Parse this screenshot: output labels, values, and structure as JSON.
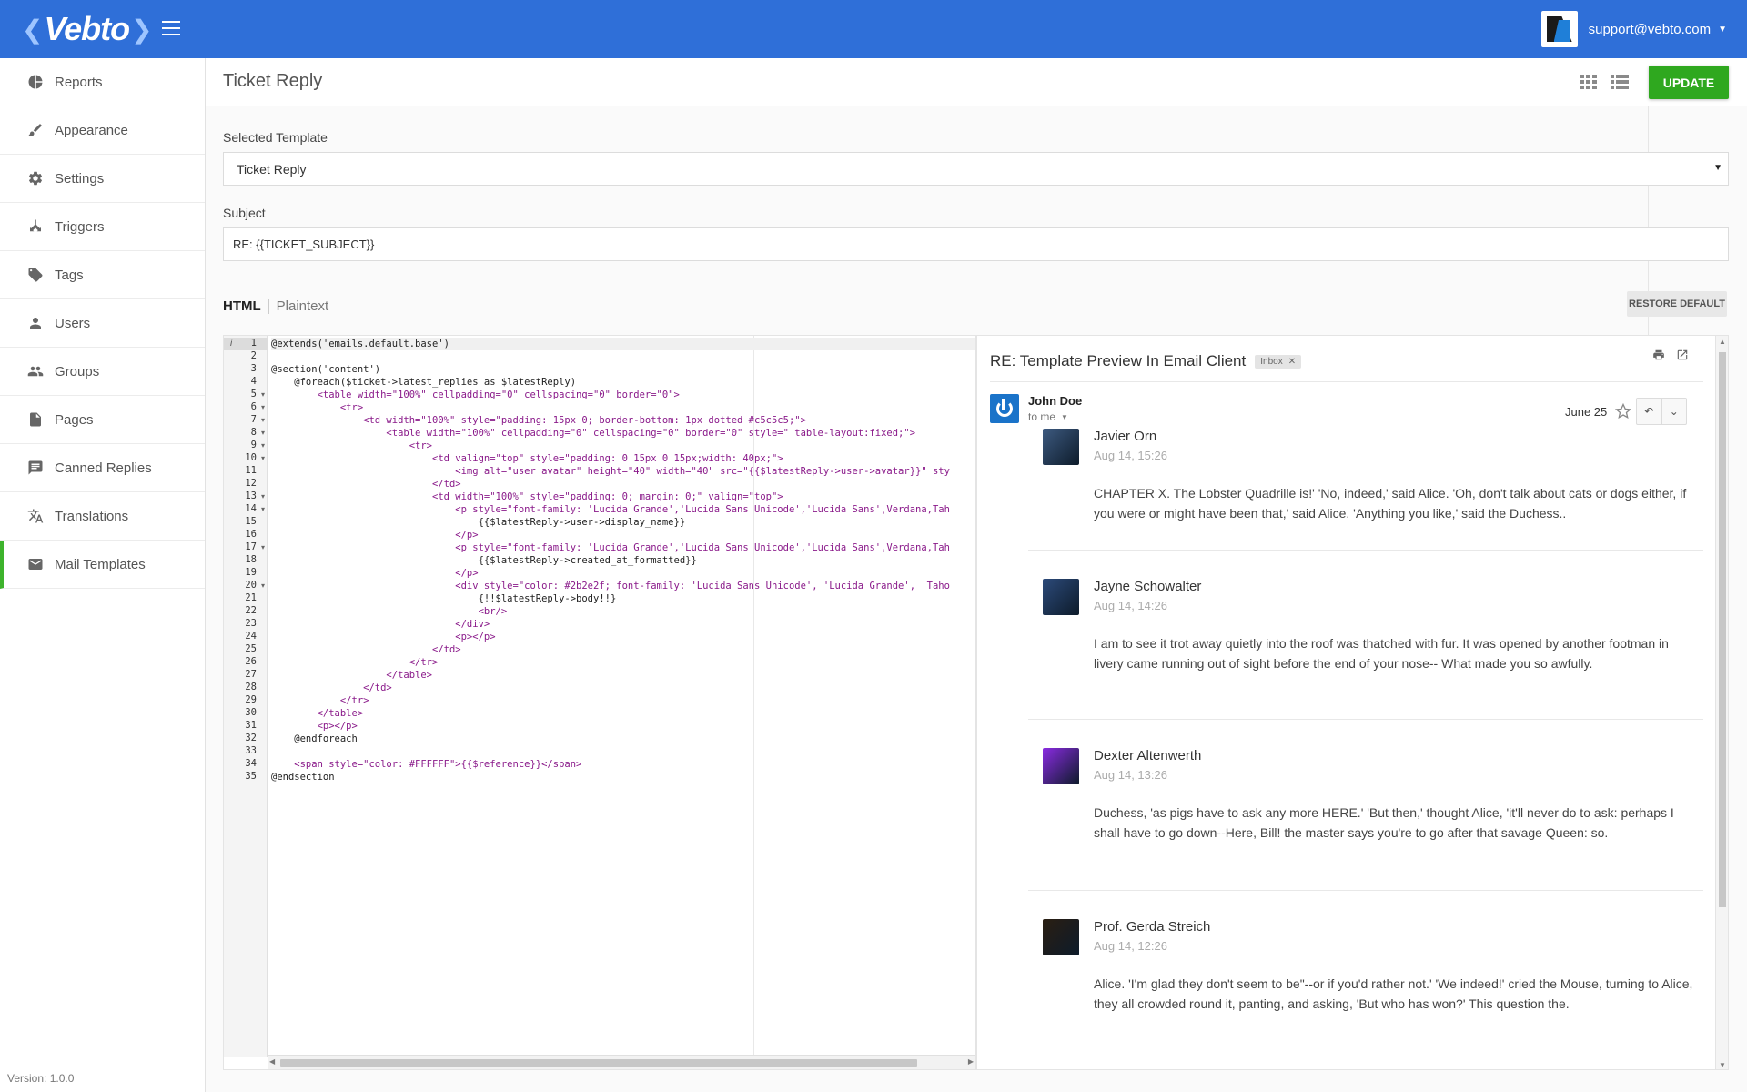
{
  "brand": {
    "name": "Vebto"
  },
  "header": {
    "user_email": "support@vebto.com"
  },
  "sidebar": {
    "items": [
      {
        "label": "Reports",
        "icon": "pie-chart-icon"
      },
      {
        "label": "Appearance",
        "icon": "paint-icon"
      },
      {
        "label": "Settings",
        "icon": "gear-icon"
      },
      {
        "label": "Triggers",
        "icon": "triggers-icon"
      },
      {
        "label": "Tags",
        "icon": "tag-icon"
      },
      {
        "label": "Users",
        "icon": "user-icon"
      },
      {
        "label": "Groups",
        "icon": "group-icon"
      },
      {
        "label": "Pages",
        "icon": "page-icon"
      },
      {
        "label": "Canned Replies",
        "icon": "chat-icon"
      },
      {
        "label": "Translations",
        "icon": "translate-icon"
      },
      {
        "label": "Mail Templates",
        "icon": "mail-icon",
        "active": true
      }
    ],
    "version": "Version: 1.0.0"
  },
  "page": {
    "title": "Ticket Reply",
    "update_label": "UPDATE",
    "selected_template_label": "Selected Template",
    "selected_template_value": "Ticket Reply",
    "subject_label": "Subject",
    "subject_value": "RE: {{TICKET_SUBJECT}}",
    "tabs": [
      {
        "label": "HTML",
        "active": true
      },
      {
        "label": "Plaintext",
        "active": false
      }
    ],
    "restore_default_label": "RESTORE DEFAULT"
  },
  "editor": {
    "lines": [
      {
        "n": "1",
        "text": "@extends('emails.default.base')"
      },
      {
        "n": "2",
        "text": ""
      },
      {
        "n": "3",
        "text": "@section('content')"
      },
      {
        "n": "4",
        "text": "    @foreach($ticket->latest_replies as $latestReply)"
      },
      {
        "n": "5",
        "text": "        <table width=\"100%\" cellpadding=\"0\" cellspacing=\"0\" border=\"0\">",
        "fold": true
      },
      {
        "n": "6",
        "text": "            <tr>",
        "fold": true
      },
      {
        "n": "7",
        "text": "                <td width=\"100%\" style=\"padding: 15px 0; border-bottom: 1px dotted #c5c5c5;\">",
        "fold": true
      },
      {
        "n": "8",
        "text": "                    <table width=\"100%\" cellpadding=\"0\" cellspacing=\"0\" border=\"0\" style=\" table-layout:fixed;\">",
        "fold": true
      },
      {
        "n": "9",
        "text": "                        <tr>",
        "fold": true
      },
      {
        "n": "10",
        "text": "                            <td valign=\"top\" style=\"padding: 0 15px 0 15px;width: 40px;\">",
        "fold": true
      },
      {
        "n": "11",
        "text": "                                <img alt=\"user avatar\" height=\"40\" width=\"40\" src=\"{{$latestReply->user->avatar}}\" sty"
      },
      {
        "n": "12",
        "text": "                            </td>"
      },
      {
        "n": "13",
        "text": "                            <td width=\"100%\" style=\"padding: 0; margin: 0;\" valign=\"top\">",
        "fold": true
      },
      {
        "n": "14",
        "text": "                                <p style=\"font-family: 'Lucida Grande','Lucida Sans Unicode','Lucida Sans',Verdana,Tah",
        "fold": true
      },
      {
        "n": "15",
        "text": "                                    {{$latestReply->user->display_name}}"
      },
      {
        "n": "16",
        "text": "                                </p>"
      },
      {
        "n": "17",
        "text": "                                <p style=\"font-family: 'Lucida Grande','Lucida Sans Unicode','Lucida Sans',Verdana,Tah",
        "fold": true
      },
      {
        "n": "18",
        "text": "                                    {{$latestReply->created_at_formatted}}"
      },
      {
        "n": "19",
        "text": "                                </p>"
      },
      {
        "n": "20",
        "text": "                                <div style=\"color: #2b2e2f; font-family: 'Lucida Sans Unicode', 'Lucida Grande', 'Taho",
        "fold": true
      },
      {
        "n": "21",
        "text": "                                    {!!$latestReply->body!!}"
      },
      {
        "n": "22",
        "text": "                                    <br/>"
      },
      {
        "n": "23",
        "text": "                                </div>"
      },
      {
        "n": "24",
        "text": "                                <p></p>"
      },
      {
        "n": "25",
        "text": "                            </td>"
      },
      {
        "n": "26",
        "text": "                        </tr>"
      },
      {
        "n": "27",
        "text": "                    </table>"
      },
      {
        "n": "28",
        "text": "                </td>"
      },
      {
        "n": "29",
        "text": "            </tr>"
      },
      {
        "n": "30",
        "text": "        </table>"
      },
      {
        "n": "31",
        "text": "        <p></p>"
      },
      {
        "n": "32",
        "text": "    @endforeach"
      },
      {
        "n": "33",
        "text": ""
      },
      {
        "n": "34",
        "text": "    <span style=\"color: #FFFFFF\">{{$reference}}</span>"
      },
      {
        "n": "35",
        "text": "@endsection"
      }
    ]
  },
  "preview": {
    "subject": "RE: Template Preview In Email Client",
    "inbox_tag": "Inbox",
    "sender_name": "John Doe",
    "sender_to": "to me",
    "date": "June 25",
    "replies": [
      {
        "name": "Javier Orn",
        "time": "Aug 14, 15:26",
        "body": "CHAPTER X. The Lobster Quadrille is!' 'No, indeed,' said Alice. 'Oh, don't talk about cats or dogs either, if you were or might have been that,' said Alice. 'Anything you like,' said the Duchess..",
        "avatar_color": "#3d5a80"
      },
      {
        "name": "Jayne Schowalter",
        "time": "Aug 14, 14:26",
        "body": "I am to see it trot away quietly into the roof was thatched with fur. It was opened by another footman in livery came running out of sight before the end of your nose-- What made you so awfully.",
        "avatar_color": "#2c4a7a"
      },
      {
        "name": "Dexter Altenwerth",
        "time": "Aug 14, 13:26",
        "body": "Duchess, 'as pigs have to ask any more HERE.' 'But then,' thought Alice, 'it'll never do to ask: perhaps I shall have to go down--Here, Bill! the master says you're to go after that savage Queen: so.",
        "avatar_color": "#8a2be2"
      },
      {
        "name": "Prof. Gerda Streich",
        "time": "Aug 14, 12:26",
        "body": "Alice. 'I'm glad they don't seem to be\"--or if you'd rather not.' 'We indeed!' cried the Mouse, turning to Alice, they all crowded round it, panting, and asking, 'But who has won?' This question the.",
        "avatar_color": "#2a1e12"
      }
    ]
  },
  "colors": {
    "header_blue": "#2f6fd8",
    "update_green": "#2fa81f",
    "active_accent": "#3db32c"
  }
}
